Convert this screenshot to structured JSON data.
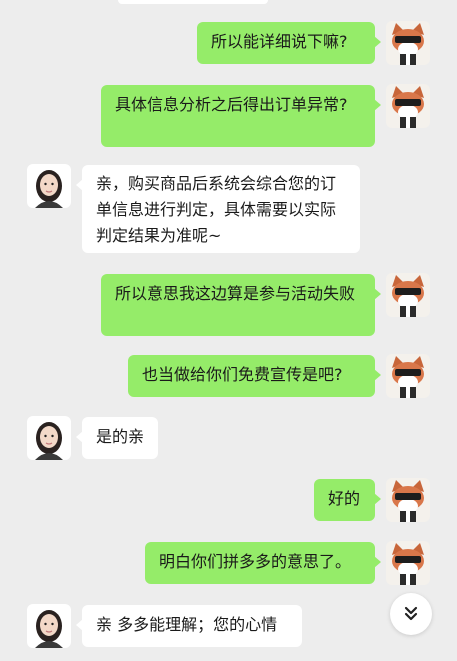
{
  "messages": [
    {
      "from": "me",
      "text": "所以能详细说下嘛?"
    },
    {
      "from": "me",
      "text": "具体信息分析之后得出订单异常?"
    },
    {
      "from": "them",
      "text": "亲，购买商品后系统会综合您的订单信息进行判定，具体需要以实际判定结果为准呢~"
    },
    {
      "from": "me",
      "text": "所以意思我这边算是参与活动失败"
    },
    {
      "from": "me",
      "text": "也当做给你们免费宣传是吧?"
    },
    {
      "from": "them",
      "text": "是的亲"
    },
    {
      "from": "me",
      "text": "好的"
    },
    {
      "from": "me",
      "text": "明白你们拼多多的意思了。"
    },
    {
      "from": "them",
      "text": "亲 多多能理解；您的心情"
    }
  ],
  "icons": {
    "scroll_down": "double-chevron-down-icon",
    "me_avatar": "cartoon-fox-sunglasses-avatar",
    "them_avatar": "agent-photo-avatar"
  },
  "colors": {
    "background": "#ededed",
    "me_bubble": "#95ec69",
    "them_bubble": "#ffffff"
  }
}
